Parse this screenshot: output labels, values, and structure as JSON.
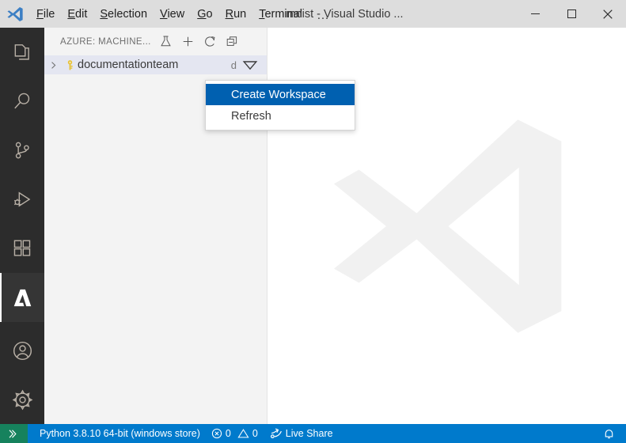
{
  "window": {
    "title": "mnist - Visual Studio ...",
    "logo_icon": "vscode-logo-icon",
    "controls": {
      "minimize": "minimize-icon",
      "maximize": "maximize-icon",
      "close": "close-icon"
    }
  },
  "menubar": {
    "items": [
      {
        "label": "File",
        "mnemonic": "F",
        "rest": "ile"
      },
      {
        "label": "Edit",
        "mnemonic": "E",
        "rest": "dit"
      },
      {
        "label": "Selection",
        "mnemonic": "S",
        "rest": "election"
      },
      {
        "label": "View",
        "mnemonic": "V",
        "rest": "iew"
      },
      {
        "label": "Go",
        "mnemonic": "G",
        "rest": "o"
      },
      {
        "label": "Run",
        "mnemonic": "R",
        "rest": "un"
      },
      {
        "label": "Terminal",
        "mnemonic": "T",
        "rest": "erminal"
      }
    ],
    "overflow_label": "…"
  },
  "activitybar": {
    "items": [
      {
        "name": "explorer",
        "icon": "files-icon",
        "active": false
      },
      {
        "name": "search",
        "icon": "search-icon",
        "active": false
      },
      {
        "name": "source-control",
        "icon": "source-control-branch-icon",
        "active": false
      },
      {
        "name": "run-and-debug",
        "icon": "run-and-debug-icon",
        "active": false
      },
      {
        "name": "extensions",
        "icon": "extensions-icon",
        "active": false
      },
      {
        "name": "azure",
        "icon": "azure-logo-icon",
        "active": true
      }
    ],
    "bottom_items": [
      {
        "name": "accounts",
        "icon": "account-circle-icon"
      },
      {
        "name": "manage-settings",
        "icon": "gear-icon"
      }
    ]
  },
  "sidebar": {
    "title": "AZURE: MACHINE...",
    "actions": [
      {
        "name": "experiment-beaker",
        "icon": "beaker-icon",
        "tooltip": "View Experiments"
      },
      {
        "name": "create-resource",
        "icon": "plus-icon",
        "tooltip": "Create"
      },
      {
        "name": "refresh",
        "icon": "refresh-icon",
        "tooltip": "Refresh"
      },
      {
        "name": "collapse-all",
        "icon": "collapse-all-icon",
        "tooltip": "Collapse All"
      }
    ],
    "tree": [
      {
        "label": "documentationteam",
        "trailing": "ԁ",
        "icon": "key-icon",
        "twisty": "chevron-right-icon",
        "dropdown": "triangle-down-icon",
        "selected": true
      }
    ]
  },
  "context_menu": {
    "items": [
      {
        "label": "Create Workspace",
        "selected": true
      },
      {
        "label": "Refresh",
        "selected": false
      }
    ]
  },
  "editor": {
    "watermark_icon": "vscode-logo-watermark-icon"
  },
  "statusbar": {
    "remote_icon": "remote-explorer-icon",
    "python_label": "Python 3.8.10 64-bit (windows store)",
    "errors": {
      "icon": "error-circle-icon",
      "count": "0"
    },
    "warnings": {
      "icon": "warning-triangle-icon",
      "count": "0"
    },
    "live_share": {
      "icon": "live-share-icon",
      "label": "Live Share"
    },
    "notifications": {
      "icon": "bell-icon"
    }
  },
  "colors": {
    "titlebar_bg": "#dddddd",
    "activitybar_bg": "#2c2c2c",
    "sidebar_bg": "#f3f3f3",
    "editor_bg": "#ffffff",
    "statusbar_bg": "#007acc",
    "remote_badge_bg": "#16825d",
    "menu_selected_bg": "#0060b0",
    "tree_selected_bg": "#e4e6f1",
    "key_icon_color": "#e8c33a",
    "watermark_color": "#f1f1f1"
  }
}
